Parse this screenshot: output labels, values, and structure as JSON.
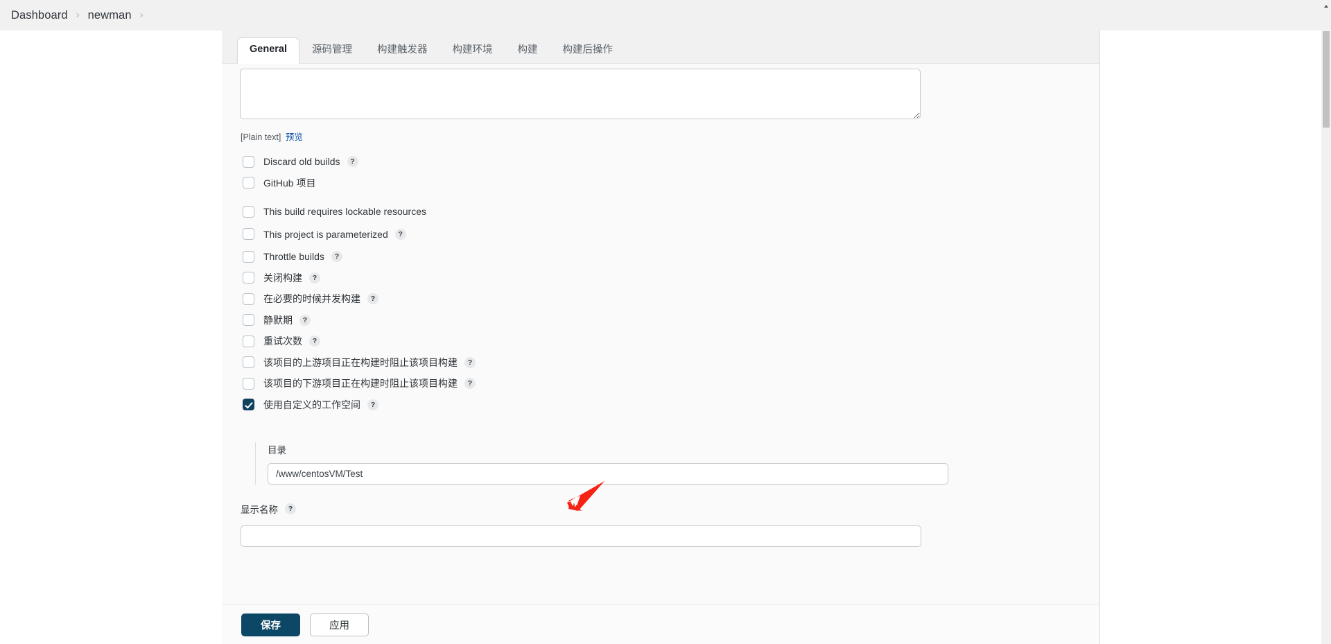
{
  "breadcrumb": {
    "items": [
      {
        "label": "Dashboard"
      },
      {
        "label": "newman"
      }
    ],
    "separator": "›"
  },
  "tabs": [
    {
      "label": "General",
      "active": true
    },
    {
      "label": "源码管理",
      "active": false
    },
    {
      "label": "构建触发器",
      "active": false
    },
    {
      "label": "构建环境",
      "active": false
    },
    {
      "label": "构建",
      "active": false
    },
    {
      "label": "构建后操作",
      "active": false
    }
  ],
  "description": {
    "value": "",
    "placeholder": "",
    "format_note": "[Plain text]",
    "preview_link": "预览"
  },
  "checkboxes": [
    {
      "label": "Discard old builds",
      "checked": false,
      "help": true,
      "help_label": "?"
    },
    {
      "label": "GitHub 项目",
      "checked": false,
      "help": false,
      "help_label": "?"
    },
    {
      "label": "This build requires lockable resources",
      "checked": false,
      "help": false,
      "help_label": "?"
    },
    {
      "label": "This project is parameterized",
      "checked": false,
      "help": true,
      "help_label": "?"
    },
    {
      "label": "Throttle builds",
      "checked": false,
      "help": true,
      "help_label": "?"
    },
    {
      "label": "关闭构建",
      "checked": false,
      "help": true,
      "help_label": "?"
    },
    {
      "label": "在必要的时候并发构建",
      "checked": false,
      "help": true,
      "help_label": "?"
    },
    {
      "label": "静默期",
      "checked": false,
      "help": true,
      "help_label": "?"
    },
    {
      "label": "重试次数",
      "checked": false,
      "help": true,
      "help_label": "?"
    },
    {
      "label": "该项目的上游项目正在构建时阻止该项目构建",
      "checked": false,
      "help": true,
      "help_label": "?"
    },
    {
      "label": "该项目的下游项目正在构建时阻止该项目构建",
      "checked": false,
      "help": true,
      "help_label": "?"
    },
    {
      "label": "使用自定义的工作空间",
      "checked": true,
      "help": true,
      "help_label": "?"
    }
  ],
  "custom_workspace": {
    "directory_label": "目录",
    "directory_value": "/www/centosVM/Test",
    "directory_placeholder": ""
  },
  "display_name": {
    "label": "显示名称",
    "help_label": "?",
    "value": "",
    "placeholder": ""
  },
  "footer": {
    "save_label": "保存",
    "apply_label": "应用"
  },
  "annotation": {
    "arrow_color": "#f52314"
  },
  "colors": {
    "accent": "#0d4766",
    "link": "#0b4fa8",
    "page_bg": "#f1f1f1",
    "card_bg": "#fafafa",
    "checkbox_checked": "#10415f"
  }
}
